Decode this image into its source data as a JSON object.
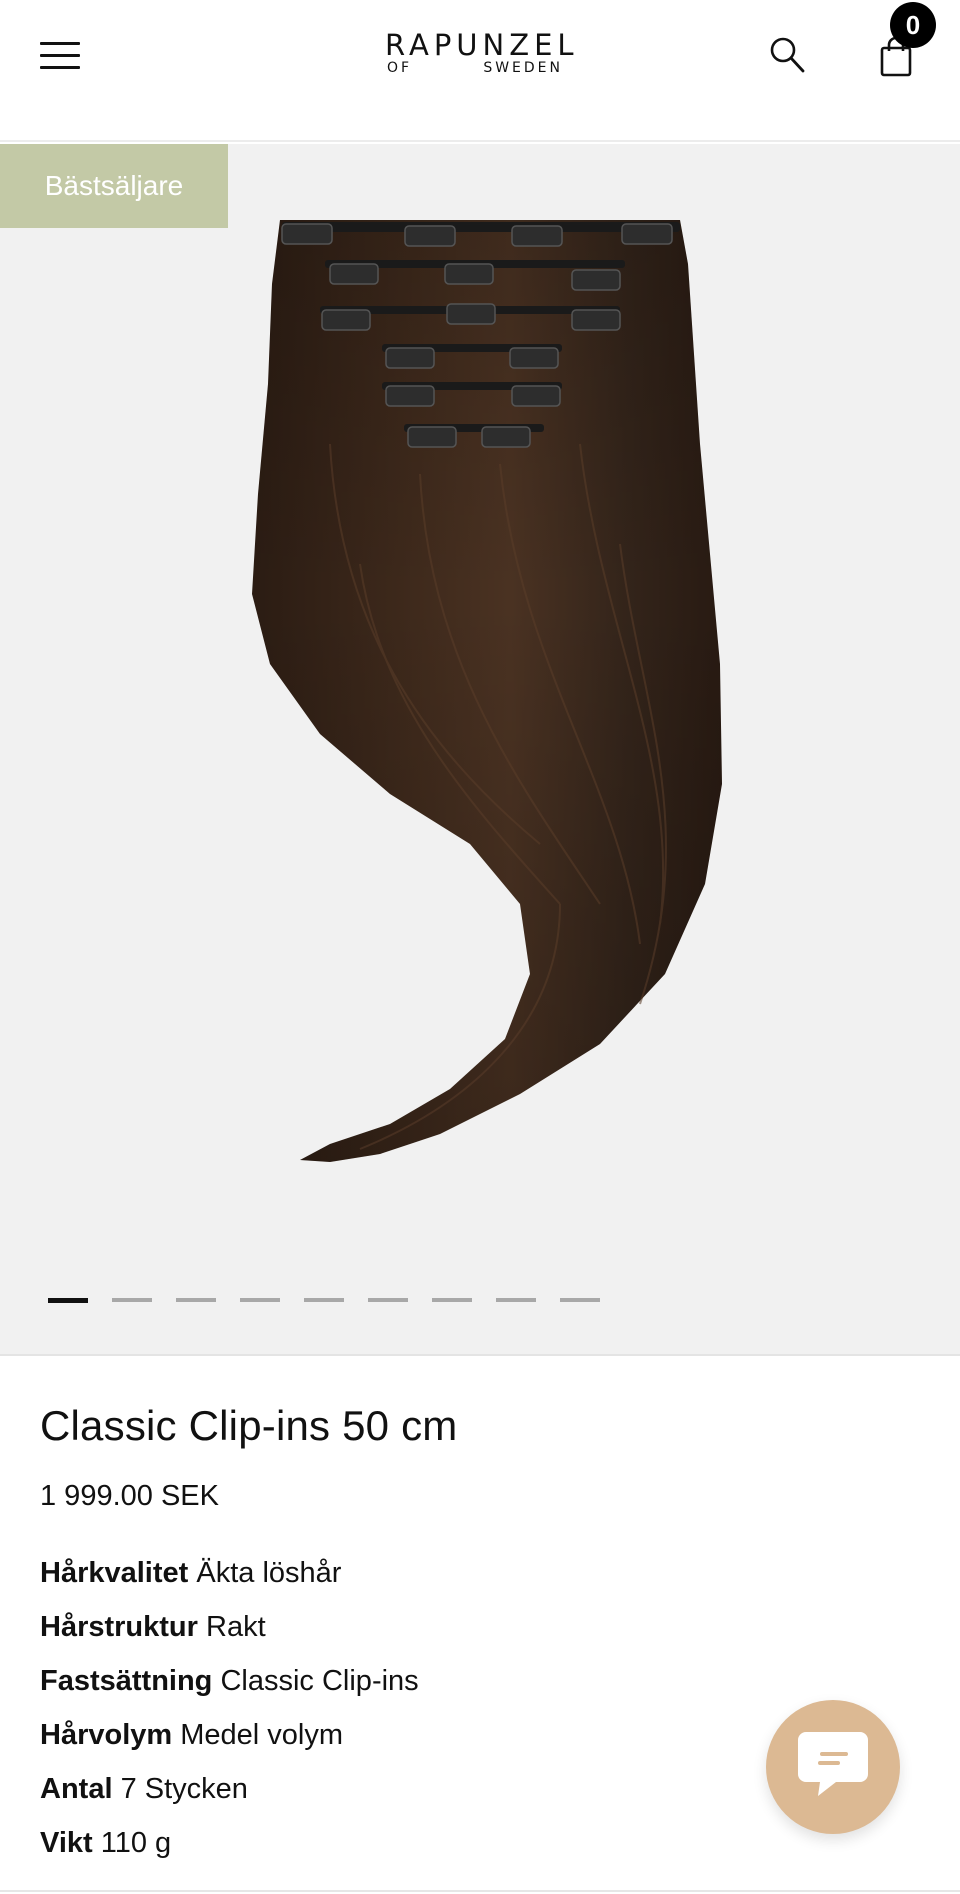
{
  "header": {
    "logo_main": "RAPUNZEL",
    "logo_sub_left": "OF",
    "logo_sub_right": "SWEDEN",
    "cart_count": "0",
    "icons": {
      "menu": "hamburger-menu-icon",
      "search": "search-icon",
      "cart": "shopping-bag-icon"
    }
  },
  "gallery": {
    "badge": "Bästsäljare",
    "badge_color": "#c3c9a6",
    "slide_count": 9,
    "active_slide": 1
  },
  "product": {
    "title": "Classic Clip-ins 50 cm",
    "price": "1 999.00 SEK",
    "specs": [
      {
        "label": "Hårkvalitet",
        "value": "Äkta löshår"
      },
      {
        "label": "Hårstruktur",
        "value": "Rakt"
      },
      {
        "label": "Fastsättning",
        "value": "Classic Clip-ins"
      },
      {
        "label": "Hårvolym",
        "value": "Medel volym"
      },
      {
        "label": "Antal",
        "value": "7 Stycken"
      },
      {
        "label": "Vikt",
        "value": "110 g"
      }
    ]
  },
  "chat": {
    "icon": "chat-bubble-icon",
    "color": "#dcb993"
  }
}
